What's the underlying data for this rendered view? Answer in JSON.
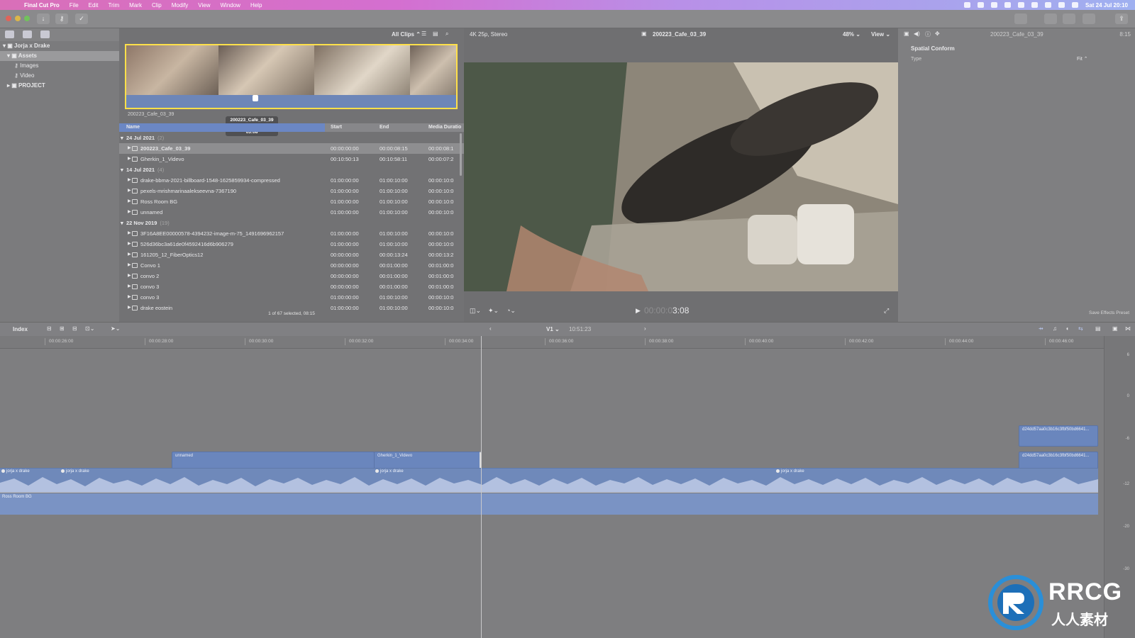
{
  "menubar": {
    "app": "Final Cut Pro",
    "items": [
      "File",
      "Edit",
      "Trim",
      "Mark",
      "Clip",
      "Modify",
      "View",
      "Window",
      "Help"
    ],
    "clock": "Sat 24 Jul  20:10"
  },
  "library": {
    "name": "Jorja x Drake",
    "items": [
      {
        "label": "Assets",
        "level": 1
      },
      {
        "label": "Images",
        "level": 2
      },
      {
        "label": "Video",
        "level": 2
      },
      {
        "label": "PROJECT",
        "level": 1
      }
    ]
  },
  "browser": {
    "filter": "All Clips",
    "format": "4K 25p, Stereo",
    "filmstrip_clip": "200223_Cafe_03_39",
    "tooltip": {
      "name": "200223_Cafe_03_39",
      "type": "Video",
      "duration": "03:08"
    },
    "columns": [
      "Name",
      "Start",
      "End",
      "Media Duratio"
    ],
    "groups": [
      {
        "label": "24 Jul 2021",
        "count": "(2)",
        "clips": [
          {
            "name": "200223_Cafe_03_39",
            "start": "00:00:00:00",
            "end": "00:00:08:15",
            "dur": "00:00:08:1",
            "selected": true
          },
          {
            "name": "Gherkin_1_Videvo",
            "start": "00:10:50:13",
            "end": "00:10:58:11",
            "dur": "00:00:07:2"
          }
        ]
      },
      {
        "label": "14 Jul 2021",
        "count": "(4)",
        "clips": [
          {
            "name": "drake-bbma-2021-billboard-1548-1625859934-compressed",
            "start": "01:00:00:00",
            "end": "01:00:10:00",
            "dur": "00:00:10:0"
          },
          {
            "name": "pexels-mrishmarinaalekseevna-7367190",
            "start": "01:00:00:00",
            "end": "01:00:10:00",
            "dur": "00:00:10:0"
          },
          {
            "name": "Ross Room BG",
            "start": "01:00:00:00",
            "end": "01:00:10:00",
            "dur": "00:00:10:0"
          },
          {
            "name": "unnamed",
            "start": "01:00:00:00",
            "end": "01:00:10:00",
            "dur": "00:00:10:0"
          }
        ]
      },
      {
        "label": "22 Nov 2019",
        "count": "(19)",
        "clips": [
          {
            "name": "3F16A8EE00000578-4394232-image-m-75_1491696962157",
            "start": "01:00:00:00",
            "end": "01:00:10:00",
            "dur": "00:00:10:0"
          },
          {
            "name": "526d36bc3a61de0f4592416d6b906279",
            "start": "01:00:00:00",
            "end": "01:00:10:00",
            "dur": "00:00:10:0"
          },
          {
            "name": "161205_12_FiberOptics12",
            "start": "00:00:00:00",
            "end": "00:00:13:24",
            "dur": "00:00:13:2"
          },
          {
            "name": "Convo 1",
            "start": "00:00:00:00",
            "end": "00:01:00:00",
            "dur": "00:01:00:0"
          },
          {
            "name": "convo 2",
            "start": "00:00:00:00",
            "end": "00:01:00:00",
            "dur": "00:01:00:0"
          },
          {
            "name": "convo 3",
            "start": "00:00:00:00",
            "end": "00:01:00:00",
            "dur": "00:01:00:0"
          },
          {
            "name": "convo 3",
            "start": "01:00:00:00",
            "end": "01:00:10:00",
            "dur": "00:00:10:0"
          },
          {
            "name": "drake eostein",
            "start": "01:00:00:00",
            "end": "01:00:10:00",
            "dur": "00:00:10:0"
          }
        ]
      }
    ],
    "footer": "1 of 67 selected, 08:15"
  },
  "viewer": {
    "clip_name": "200223_Cafe_03_39",
    "zoom": "48%",
    "view": "View",
    "timecode_dim": "00:00:0",
    "timecode": "3:08"
  },
  "inspector": {
    "clip_name": "200223_Cafe_03_39",
    "duration": "8:15",
    "section": "Spatial Conform",
    "field_label": "Type",
    "field_value": "Fit",
    "save_preset": "Save Effects Preset"
  },
  "timeline": {
    "index_label": "Index",
    "track": "V1",
    "position": "10:51:23",
    "ruler": [
      "00:00:26:00",
      "00:00:28:00",
      "00:00:30:00",
      "00:00:32:00",
      "00:00:34:00",
      "00:00:36:00",
      "00:00:38:00",
      "00:00:40:00",
      "00:00:42:00",
      "00:00:44:00",
      "00:00:46:00"
    ],
    "clips": {
      "unnamed": "unnamed",
      "gherkin": "Gherkin_1_Videvo",
      "right1": "d24dd57aa0c3b16c3fbf50bd6641...",
      "right2": "d24dd57aa0c3b16c3fbf50bd6641..."
    },
    "audio_labels": [
      "jorja x drake",
      "jorja x drake",
      "jorja x drake",
      "jorja x drake"
    ],
    "music": "Ross Room BG",
    "meter_labels": [
      "6",
      "0",
      "-6",
      "-12",
      "-20",
      "-30"
    ]
  },
  "watermark": {
    "top": "RRCG",
    "bottom": "人人素材"
  }
}
